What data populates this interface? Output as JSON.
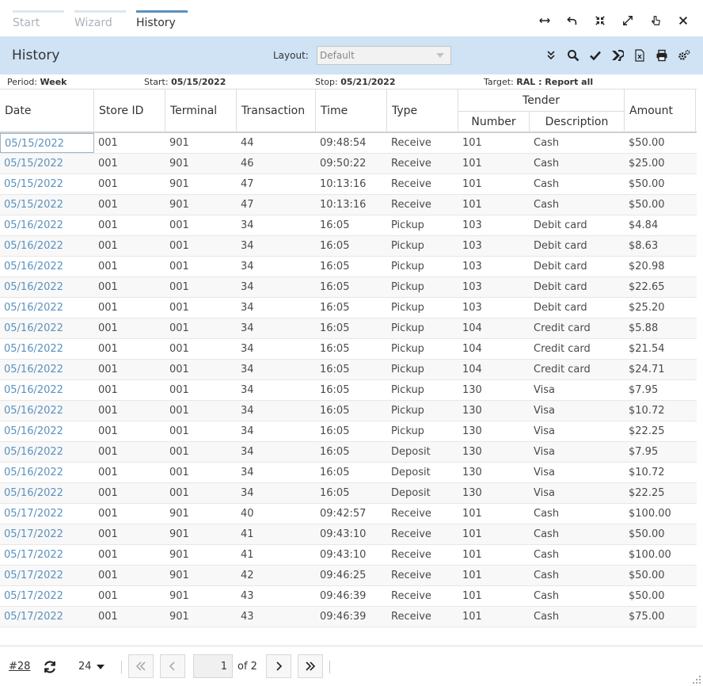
{
  "tabs": [
    {
      "label": "Start",
      "state": "inactive"
    },
    {
      "label": "Wizard",
      "state": "inactive"
    },
    {
      "label": "History",
      "state": "active"
    }
  ],
  "window_icons": [
    "resize-horizontal-icon",
    "undo-icon",
    "collapse-icon",
    "expand-icon",
    "pointer-icon",
    "close-icon"
  ],
  "header": {
    "title": "History",
    "layout_label": "Layout:",
    "layout_value": "Default",
    "tools": [
      "chevron-double-down-icon",
      "search-icon",
      "check-icon",
      "merge-icon",
      "excel-icon",
      "print-icon",
      "settings-icon"
    ]
  },
  "info": {
    "period_label": "Period:",
    "period_value": "Week",
    "start_label": "Start:",
    "start_value": "05/15/2022",
    "stop_label": "Stop:",
    "stop_value": "05/21/2022",
    "target_label": "Target:",
    "target_value": "RAL : Report all"
  },
  "columns": {
    "date": "Date",
    "store_id": "Store ID",
    "terminal": "Terminal",
    "transaction": "Transaction",
    "time": "Time",
    "type": "Type",
    "tender": "Tender",
    "number": "Number",
    "description": "Description",
    "amount": "Amount"
  },
  "rows": [
    [
      "05/15/2022",
      "001",
      "901",
      "44",
      "09:48:54",
      "Receive",
      "101",
      "Cash",
      "$50.00"
    ],
    [
      "05/15/2022",
      "001",
      "901",
      "46",
      "09:50:22",
      "Receive",
      "101",
      "Cash",
      "$25.00"
    ],
    [
      "05/15/2022",
      "001",
      "901",
      "47",
      "10:13:16",
      "Receive",
      "101",
      "Cash",
      "$50.00"
    ],
    [
      "05/15/2022",
      "001",
      "901",
      "47",
      "10:13:16",
      "Receive",
      "101",
      "Cash",
      "$50.00"
    ],
    [
      "05/16/2022",
      "001",
      "001",
      "34",
      "16:05",
      "Pickup",
      "103",
      "Debit card",
      "$4.84"
    ],
    [
      "05/16/2022",
      "001",
      "001",
      "34",
      "16:05",
      "Pickup",
      "103",
      "Debit card",
      "$8.63"
    ],
    [
      "05/16/2022",
      "001",
      "001",
      "34",
      "16:05",
      "Pickup",
      "103",
      "Debit card",
      "$20.98"
    ],
    [
      "05/16/2022",
      "001",
      "001",
      "34",
      "16:05",
      "Pickup",
      "103",
      "Debit card",
      "$22.65"
    ],
    [
      "05/16/2022",
      "001",
      "001",
      "34",
      "16:05",
      "Pickup",
      "103",
      "Debit card",
      "$25.20"
    ],
    [
      "05/16/2022",
      "001",
      "001",
      "34",
      "16:05",
      "Pickup",
      "104",
      "Credit card",
      "$5.88"
    ],
    [
      "05/16/2022",
      "001",
      "001",
      "34",
      "16:05",
      "Pickup",
      "104",
      "Credit card",
      "$21.54"
    ],
    [
      "05/16/2022",
      "001",
      "001",
      "34",
      "16:05",
      "Pickup",
      "104",
      "Credit card",
      "$24.71"
    ],
    [
      "05/16/2022",
      "001",
      "001",
      "34",
      "16:05",
      "Pickup",
      "130",
      "Visa",
      "$7.95"
    ],
    [
      "05/16/2022",
      "001",
      "001",
      "34",
      "16:05",
      "Pickup",
      "130",
      "Visa",
      "$10.72"
    ],
    [
      "05/16/2022",
      "001",
      "001",
      "34",
      "16:05",
      "Pickup",
      "130",
      "Visa",
      "$22.25"
    ],
    [
      "05/16/2022",
      "001",
      "001",
      "34",
      "16:05",
      "Deposit",
      "130",
      "Visa",
      "$7.95"
    ],
    [
      "05/16/2022",
      "001",
      "001",
      "34",
      "16:05",
      "Deposit",
      "130",
      "Visa",
      "$10.72"
    ],
    [
      "05/16/2022",
      "001",
      "001",
      "34",
      "16:05",
      "Deposit",
      "130",
      "Visa",
      "$22.25"
    ],
    [
      "05/17/2022",
      "001",
      "901",
      "40",
      "09:42:57",
      "Receive",
      "101",
      "Cash",
      "$100.00"
    ],
    [
      "05/17/2022",
      "001",
      "901",
      "41",
      "09:43:10",
      "Receive",
      "101",
      "Cash",
      "$50.00"
    ],
    [
      "05/17/2022",
      "001",
      "901",
      "41",
      "09:43:10",
      "Receive",
      "101",
      "Cash",
      "$100.00"
    ],
    [
      "05/17/2022",
      "001",
      "901",
      "42",
      "09:46:25",
      "Receive",
      "101",
      "Cash",
      "$50.00"
    ],
    [
      "05/17/2022",
      "001",
      "901",
      "43",
      "09:46:39",
      "Receive",
      "101",
      "Cash",
      "$50.00"
    ],
    [
      "05/17/2022",
      "001",
      "901",
      "43",
      "09:46:39",
      "Receive",
      "101",
      "Cash",
      "$75.00"
    ]
  ],
  "pager": {
    "count": "#28",
    "page_size": "24",
    "current_page": "1",
    "of_pages": "of 2"
  },
  "colors": {
    "accent": "#5b91bd",
    "header_band": "#cfe3f5"
  }
}
